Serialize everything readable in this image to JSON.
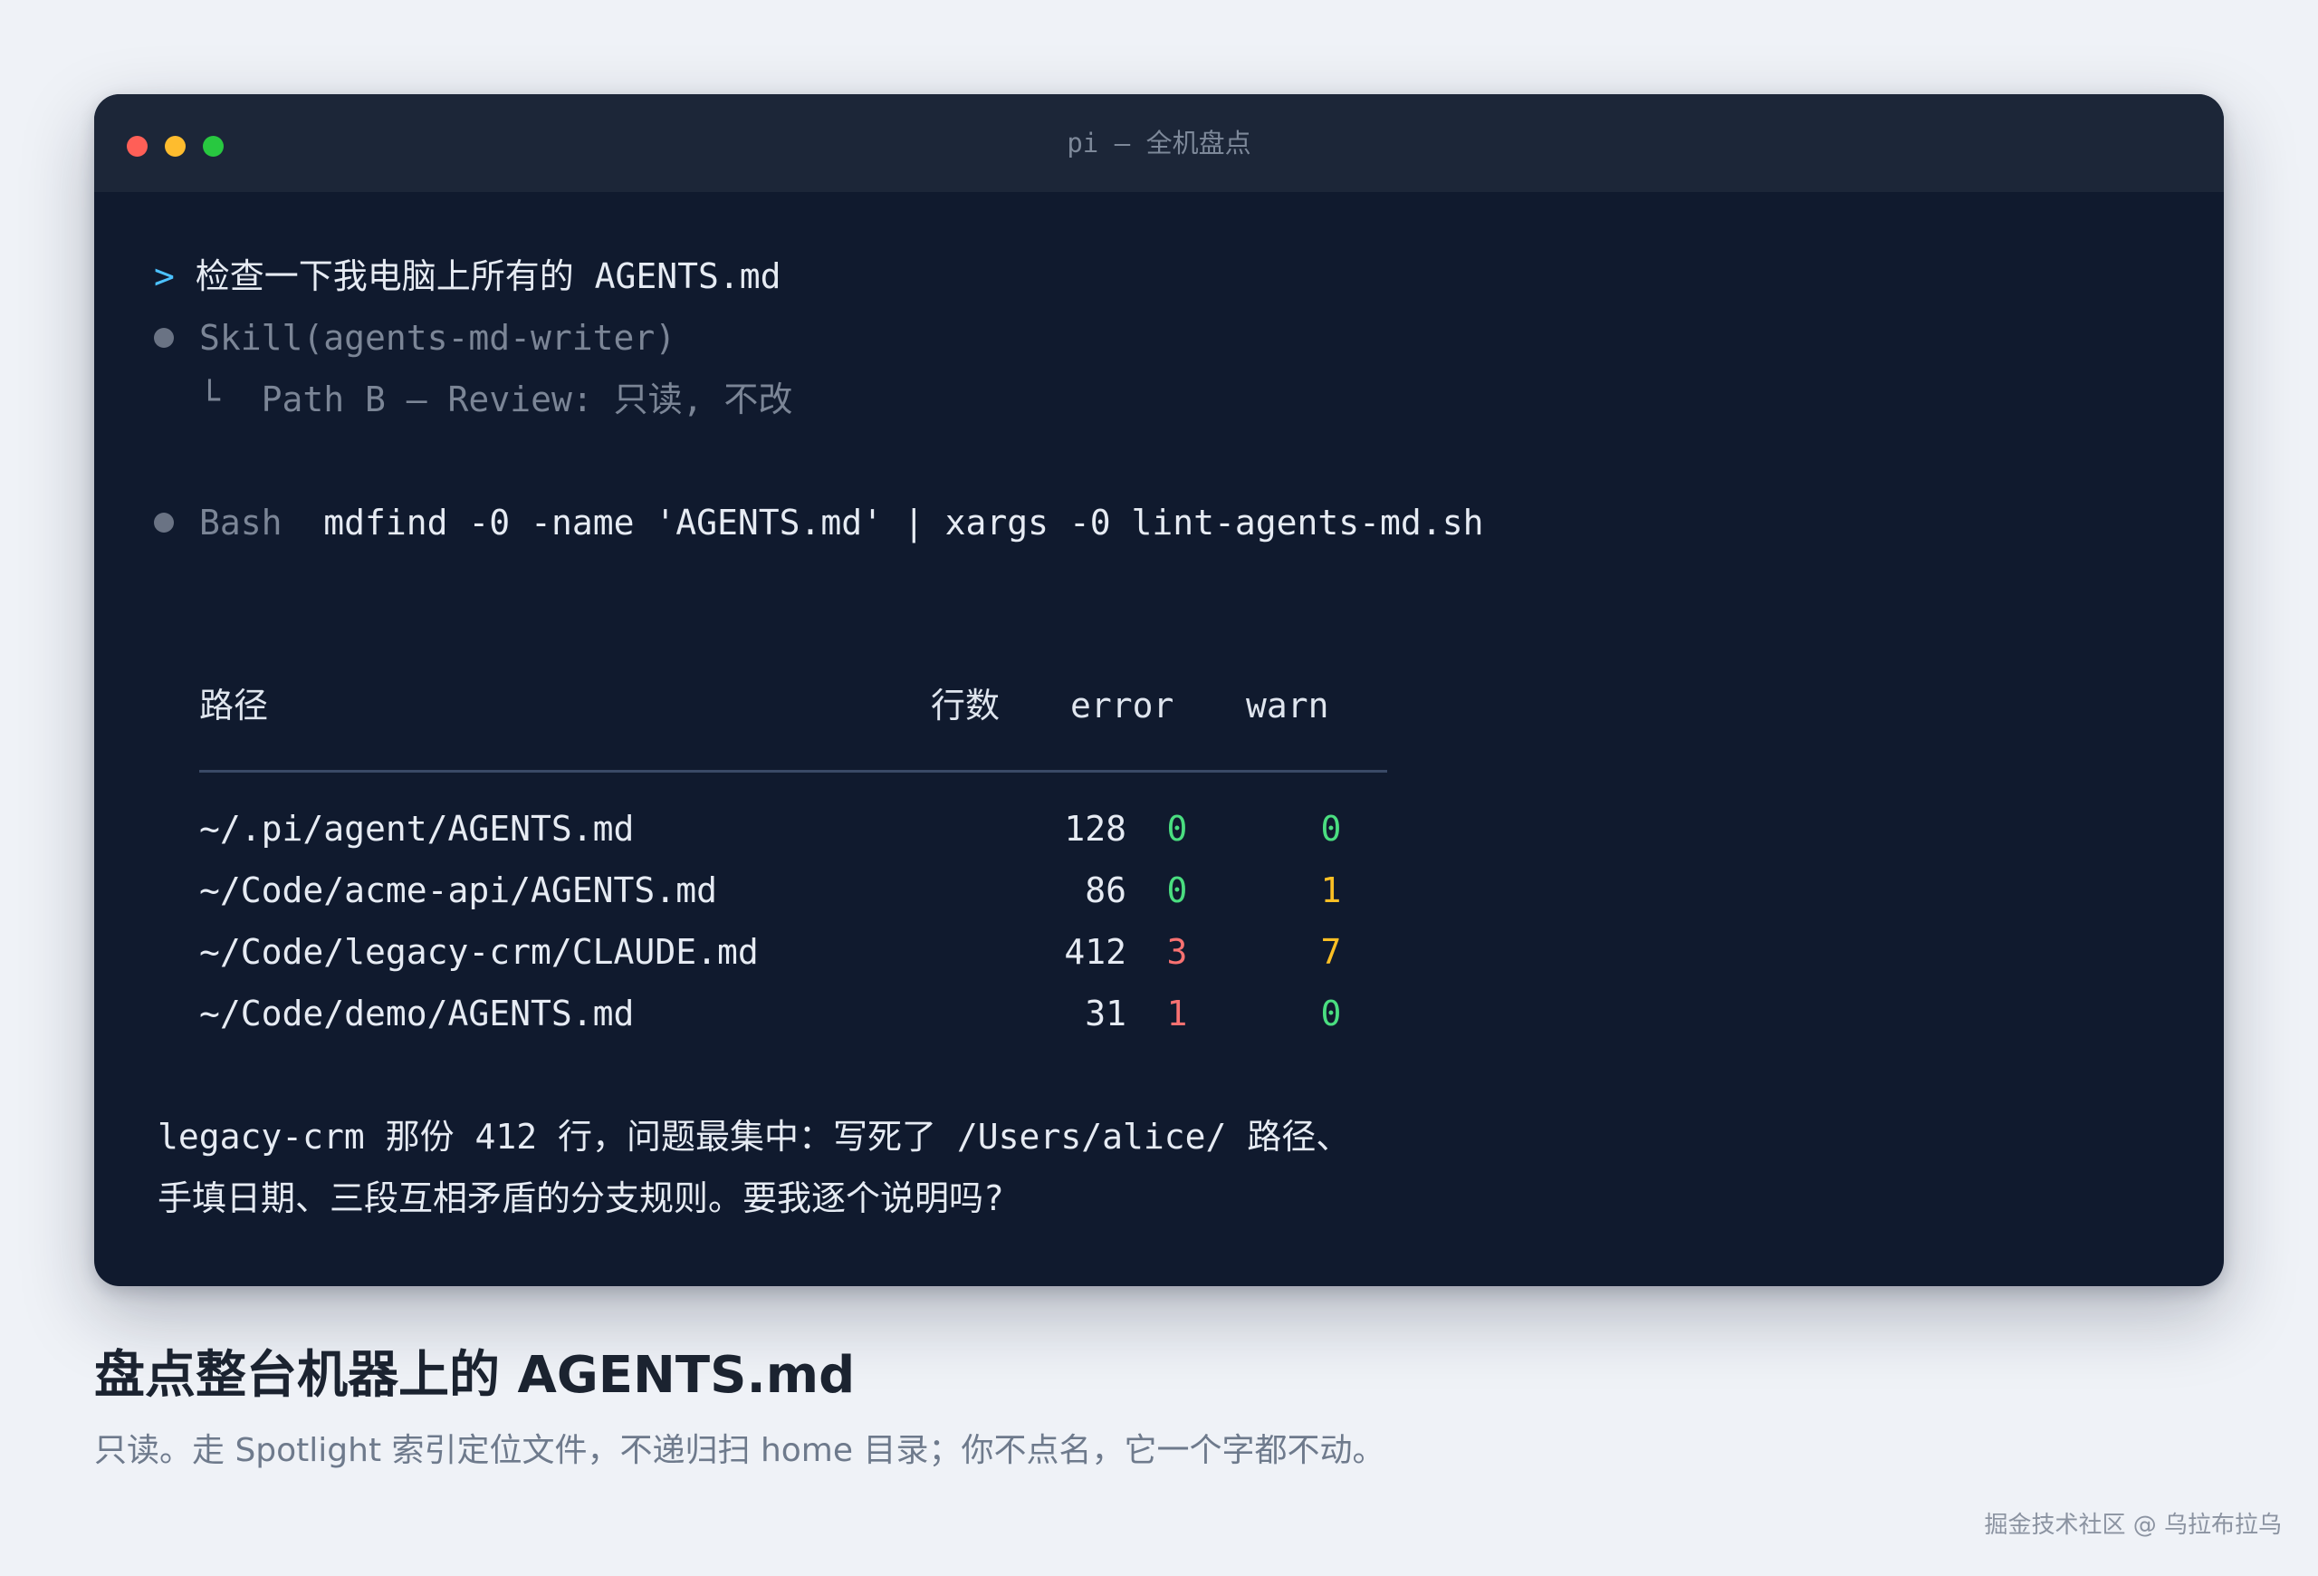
{
  "window": {
    "title": "pi — 全机盘点",
    "traffic_lights": {
      "close": "#ff5f57",
      "minimize": "#febc2e",
      "zoom": "#28c840"
    }
  },
  "prompt": {
    "symbol": ">",
    "text": "检查一下我电脑上所有的 AGENTS.md"
  },
  "skill_call": {
    "text": "Skill(agents-md-writer)",
    "branch_symbol": "└",
    "detail": "Path B — Review: 只读, 不改"
  },
  "bash_call": {
    "tool": "Bash",
    "command": "mdfind -0 -name 'AGENTS.md' | xargs -0 lint-agents-md.sh"
  },
  "table": {
    "headers": {
      "path": "路径",
      "lines": "行数",
      "error": "error",
      "warn": "warn"
    },
    "rows": [
      {
        "path": "~/.pi/agent/AGENTS.md",
        "lines": "128",
        "error": "0",
        "warn": "0",
        "error_status": "ok",
        "warn_status": "ok"
      },
      {
        "path": "~/Code/acme-api/AGENTS.md",
        "lines": "86",
        "error": "0",
        "warn": "1",
        "error_status": "ok",
        "warn_status": "warn"
      },
      {
        "path": "~/Code/legacy-crm/CLAUDE.md",
        "lines": "412",
        "error": "3",
        "warn": "7",
        "error_status": "err",
        "warn_status": "warn"
      },
      {
        "path": "~/Code/demo/AGENTS.md",
        "lines": "31",
        "error": "1",
        "warn": "0",
        "error_status": "err",
        "warn_status": "ok"
      }
    ],
    "status_colors": {
      "ok": "#4ade80",
      "warn": "#fbbf24",
      "err": "#f87171"
    }
  },
  "summary": {
    "line1": "legacy-crm 那份 412 行，问题最集中：写死了 /Users/alice/ 路径、",
    "line2": "手填日期、三段互相矛盾的分支规则。要我逐个说明吗?"
  },
  "caption": {
    "title": "盘点整台机器上的 AGENTS.md",
    "subtitle": "只读。走 Spotlight 索引定位文件，不递归扫 home 目录；你不点名，它一个字都不动。"
  },
  "watermark": "掘金技术社区 @ 乌拉布拉乌",
  "colors": {
    "page_bg": "#eff2f7",
    "terminal_bg": "#101a2e",
    "titlebar_bg": "#1c2638",
    "prompt_accent": "#4cc2ff"
  }
}
